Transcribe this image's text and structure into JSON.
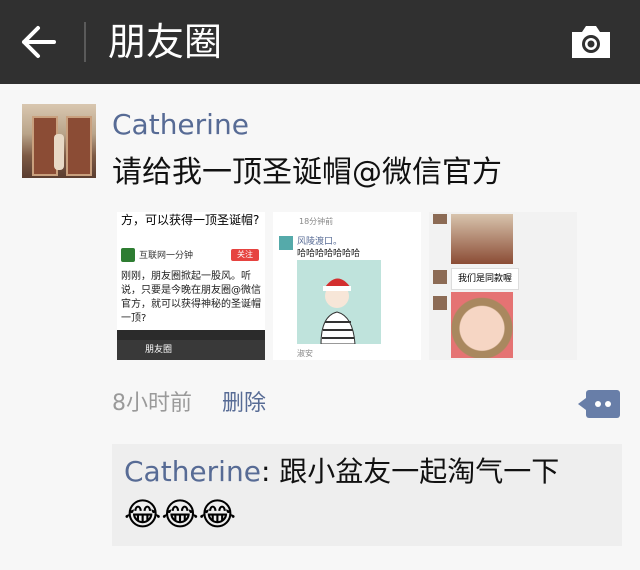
{
  "topbar": {
    "back_icon": "arrow-left-icon",
    "title": "朋友圈",
    "camera_icon": "camera-icon"
  },
  "post": {
    "author": "Catherine",
    "text": "请给我一顶圣诞帽@微信官方",
    "images": [
      {
        "top_text": "方，可以获得一顶圣诞帽?",
        "source_name": "互联网一分钟",
        "follow_label": "关注",
        "body": "刚刚，朋友圈掀起一股风。听说，只要是今晚在朋友圈@微信官方，就可以获得神秘的圣诞帽一顶?",
        "nav_title": "朋友圈"
      },
      {
        "time": "18分钟前",
        "user": "风陵渡口。",
        "text": "哈哈哈哈哈哈哈",
        "caption": "淑安"
      },
      {
        "bubble": "我们是同款喔"
      }
    ],
    "time": "8小时前",
    "delete_label": "删除"
  },
  "comments": [
    {
      "name": "Catherine",
      "sep": ": ",
      "text": "跟小盆友一起淘气一下",
      "emojis": "😂😂😂"
    }
  ],
  "colors": {
    "topbar": "#303030",
    "link": "#576b95",
    "comment_bg": "#eeeeee"
  }
}
